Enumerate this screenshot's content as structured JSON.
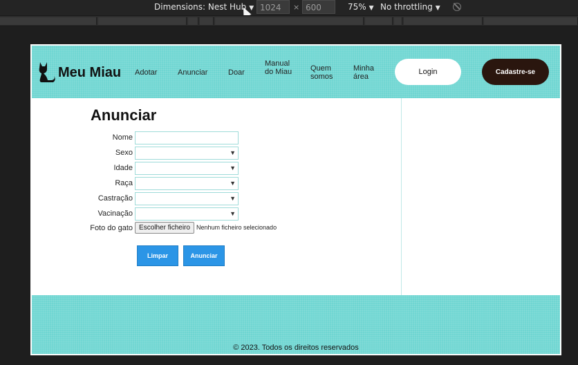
{
  "devtools": {
    "dimensions_label": "Dimensions: Nest Hub",
    "width_value": "1024",
    "height_value": "600",
    "times": "×",
    "zoom": "75%",
    "throttling": "No throttling",
    "caret": "▼"
  },
  "site": {
    "brand": "Meu Miau",
    "nav": {
      "adotar": "Adotar",
      "anunciar": "Anunciar",
      "doar": "Doar",
      "manual": "Manual do Miau",
      "quem": "Quem somos",
      "minha": "Minha área"
    },
    "login": "Login",
    "cadastro": "Cadastre-se"
  },
  "form": {
    "title": "Anunciar",
    "labels": {
      "nome": "Nome",
      "sexo": "Sexo",
      "idade": "Idade",
      "raca": "Raça",
      "castracao": "Castração",
      "vacinacao": "Vacinação",
      "foto": "Foto do gato"
    },
    "file_button": "Escolher ficheiro",
    "file_status": "Nenhum ficheiro selecionado",
    "limpar": "Limpar",
    "anunciar": "Anunciar"
  },
  "footer": {
    "text": "© 2023. Todos os direitos reservados"
  },
  "colors": {
    "header_bg": "#6fd6d2",
    "button_blue": "#2b95e6",
    "cadastro_bg": "#2a160e"
  },
  "icons": [
    "cat-logo-icon",
    "rotate-icon",
    "cursor-icon",
    "select-arrow-icon"
  ]
}
